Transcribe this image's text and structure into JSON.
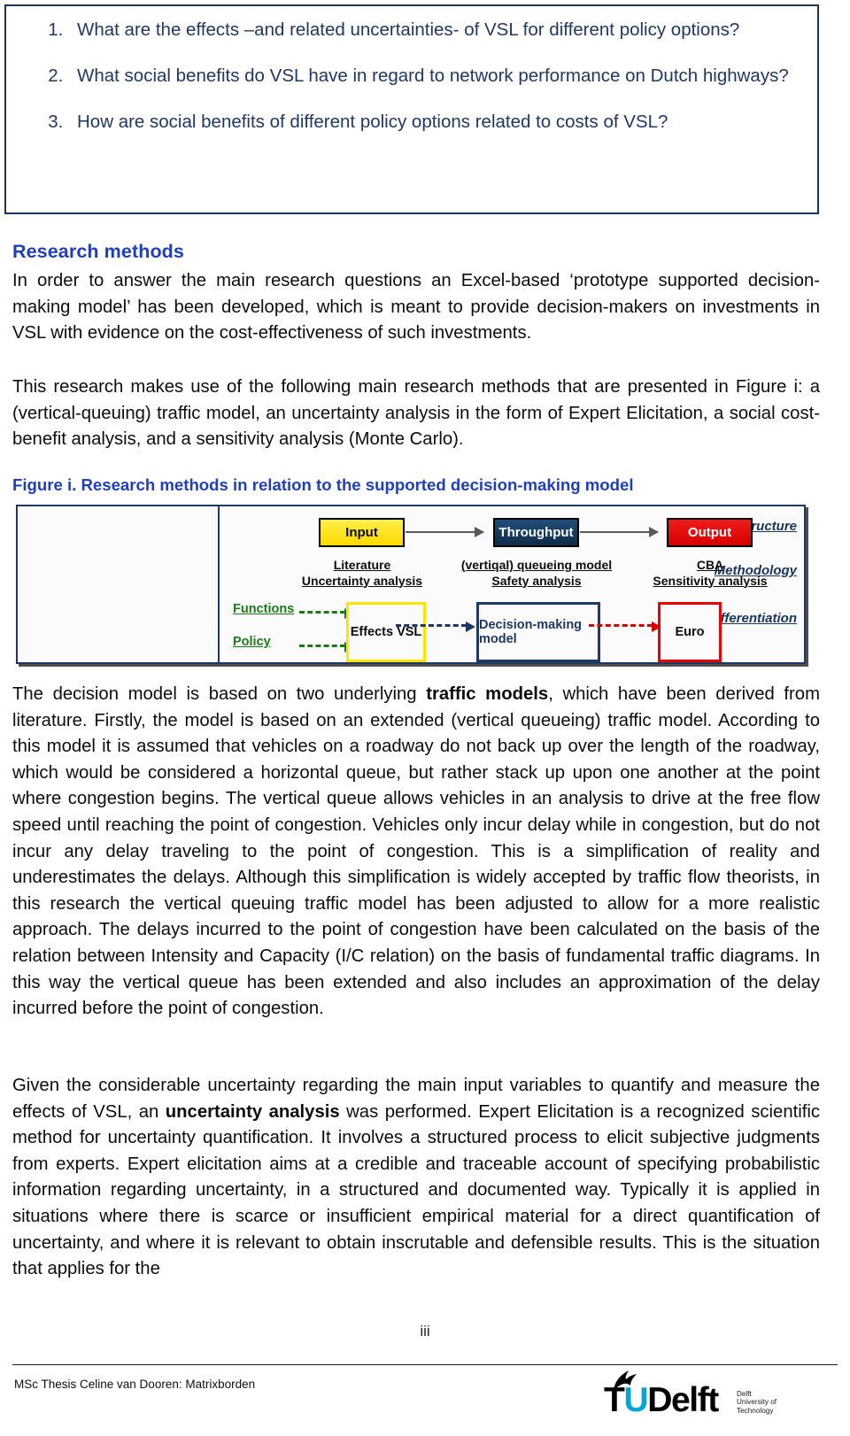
{
  "questions": {
    "items": [
      "What are  the effects –and related uncertainties- of VSL for different policy options?",
      "What social benefits do VSL have in regard to network performance on Dutch highways?",
      "How are social benefits of different policy options related to costs of VSL?"
    ]
  },
  "research_methods": {
    "heading": "Research methods",
    "paragraph_intro": "In order to answer the main research questions an Excel-based ‘prototype supported decision-making model’ has been developed, which is meant to provide decision-makers on investments in VSL with evidence on the cost-effectiveness of such investments.",
    "paragraph_methods": "This research makes use of the following main research methods that are presented in Figure i: a (vertical-queuing) traffic model, an uncertainty analysis in the form of Expert Elicitation, a social cost- benefit analysis, and a sensitivity analysis (Monte Carlo)."
  },
  "figure": {
    "caption": "Figure i. Research methods in relation to the supported decision-making model",
    "row_labels": {
      "structure": "Structure",
      "methodology": "Methodology",
      "differentiation": "Differentiation"
    },
    "structure_stages": {
      "input": "Input",
      "throughput": "Throughput",
      "output": "Output"
    },
    "methodology": {
      "input_line1": "Literature",
      "input_line2": "Uncertainty analysis",
      "throughput_line1": "(vertiqal) queueing model",
      "throughput_line2": "Safety analysis",
      "output_line1": "CBA",
      "output_line2": "Sensitivity analysis"
    },
    "differentiation": {
      "functions": "Functions",
      "policy": "Policy",
      "effects_box": "Effects VSL",
      "decision_box": "Decision-making model",
      "euro_box": "Euro"
    },
    "colors": {
      "input": "#ffd900",
      "throughput": "#1f4e79",
      "output": "#d60000",
      "accent_green": "#1a7a1a",
      "navy": "#1f3864"
    }
  },
  "body": {
    "paragraph_traffic": "The decision model is based on two underlying <b>traffic models</b>, which have been derived from literature. Firstly, the model is based on an extended (vertical queueing) traffic model. According to this model it is assumed that vehicles on a roadway do not back up over the length of the roadway, which would be considered a horizontal queue, but rather stack up upon one another at the point where congestion begins. The vertical queue allows vehicles in an analysis to drive at the free flow speed until reaching the point of congestion. Vehicles only incur delay while in congestion, but do not incur any delay traveling to the point of congestion. This is a simplification of reality and underestimates the delays. Although this simplification is widely accepted by traffic flow theorists, in this research the vertical queuing traffic model has been adjusted to allow for a more realistic approach. The delays incurred to the point of congestion have been calculated on the basis of the relation between Intensity and Capacity (I/C relation) on the basis of fundamental traffic diagrams. In this way the vertical queue has been extended and also includes an approximation of the delay incurred before the point of congestion.",
    "paragraph_uncertainty": "Given the considerable uncertainty regarding the main input variables to quantify and measure the effects of VSL, an <b>uncertainty analysis</b> was performed. Expert Elicitation is a recognized scientific method for uncertainty quantification. It involves a structured process to elicit subjective judgments from experts. Expert elicitation aims at a credible and traceable account of specifying probabilistic information regarding uncertainty, in a structured and documented way. Typically it is applied in situations where there is scarce or insufficient empirical material for a direct quantification of uncertainty, and where it is relevant to obtain inscrutable and defensible results. This is the situation that applies for the"
  },
  "footer": {
    "page_number": "iii",
    "note": "MSc Thesis Celine van Dooren: Matrixborden",
    "logo": {
      "tu": "TU",
      "delft": "Delft",
      "subtitle_line1": "Delft",
      "subtitle_line2": "University of",
      "subtitle_line3": "Technology"
    }
  }
}
